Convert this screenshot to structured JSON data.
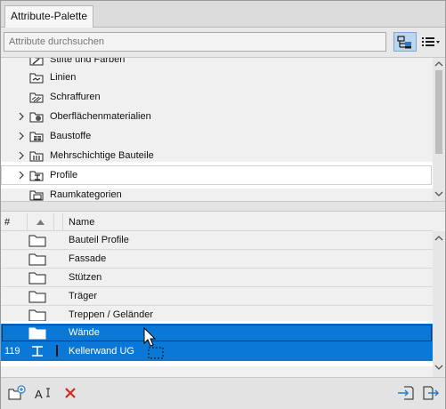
{
  "window": {
    "title": "Attribute-Palette"
  },
  "search": {
    "placeholder": "Attribute durchsuchen",
    "value": ""
  },
  "toolbar": {
    "icons": [
      "folder-tree-icon",
      "list-menu-icon"
    ]
  },
  "tree": {
    "items": [
      {
        "label": "Stifte und Farben",
        "icon": "pens-icon",
        "expandable": false
      },
      {
        "label": "Linien",
        "icon": "lines-icon",
        "expandable": false
      },
      {
        "label": "Schraffuren",
        "icon": "hatch-icon",
        "expandable": false
      },
      {
        "label": "Oberflächenmaterialien",
        "icon": "surfaces-icon",
        "expandable": true
      },
      {
        "label": "Baustoffe",
        "icon": "building-materials-icon",
        "expandable": true
      },
      {
        "label": "Mehrschichtige Bauteile",
        "icon": "composites-icon",
        "expandable": true
      },
      {
        "label": "Profile",
        "icon": "profiles-icon",
        "expandable": true,
        "selected": true
      },
      {
        "label": "Raumkategorien",
        "icon": "zone-categories-icon",
        "expandable": false
      }
    ]
  },
  "list": {
    "columns": {
      "number": "#",
      "name": "Name"
    },
    "rows": [
      {
        "num": "",
        "name": "Bauteil Profile",
        "type": "folder"
      },
      {
        "num": "",
        "name": "Fassade",
        "type": "folder"
      },
      {
        "num": "",
        "name": "Stützen",
        "type": "folder"
      },
      {
        "num": "",
        "name": "Träger",
        "type": "folder"
      },
      {
        "num": "",
        "name": "Treppen / Geländer",
        "type": "folder"
      },
      {
        "num": "",
        "name": "Wände",
        "type": "folder",
        "selected": true
      },
      {
        "num": "119",
        "name": "Kellerwand UG",
        "type": "profile",
        "selected": true
      }
    ]
  },
  "bottom": {
    "icons": [
      "new-folder-icon",
      "rename-icon",
      "delete-icon",
      "import-icon",
      "export-icon"
    ]
  },
  "colors": {
    "selection": "#0a78d7",
    "delete": "#d22a1e",
    "accent": "#2a7ac8"
  }
}
